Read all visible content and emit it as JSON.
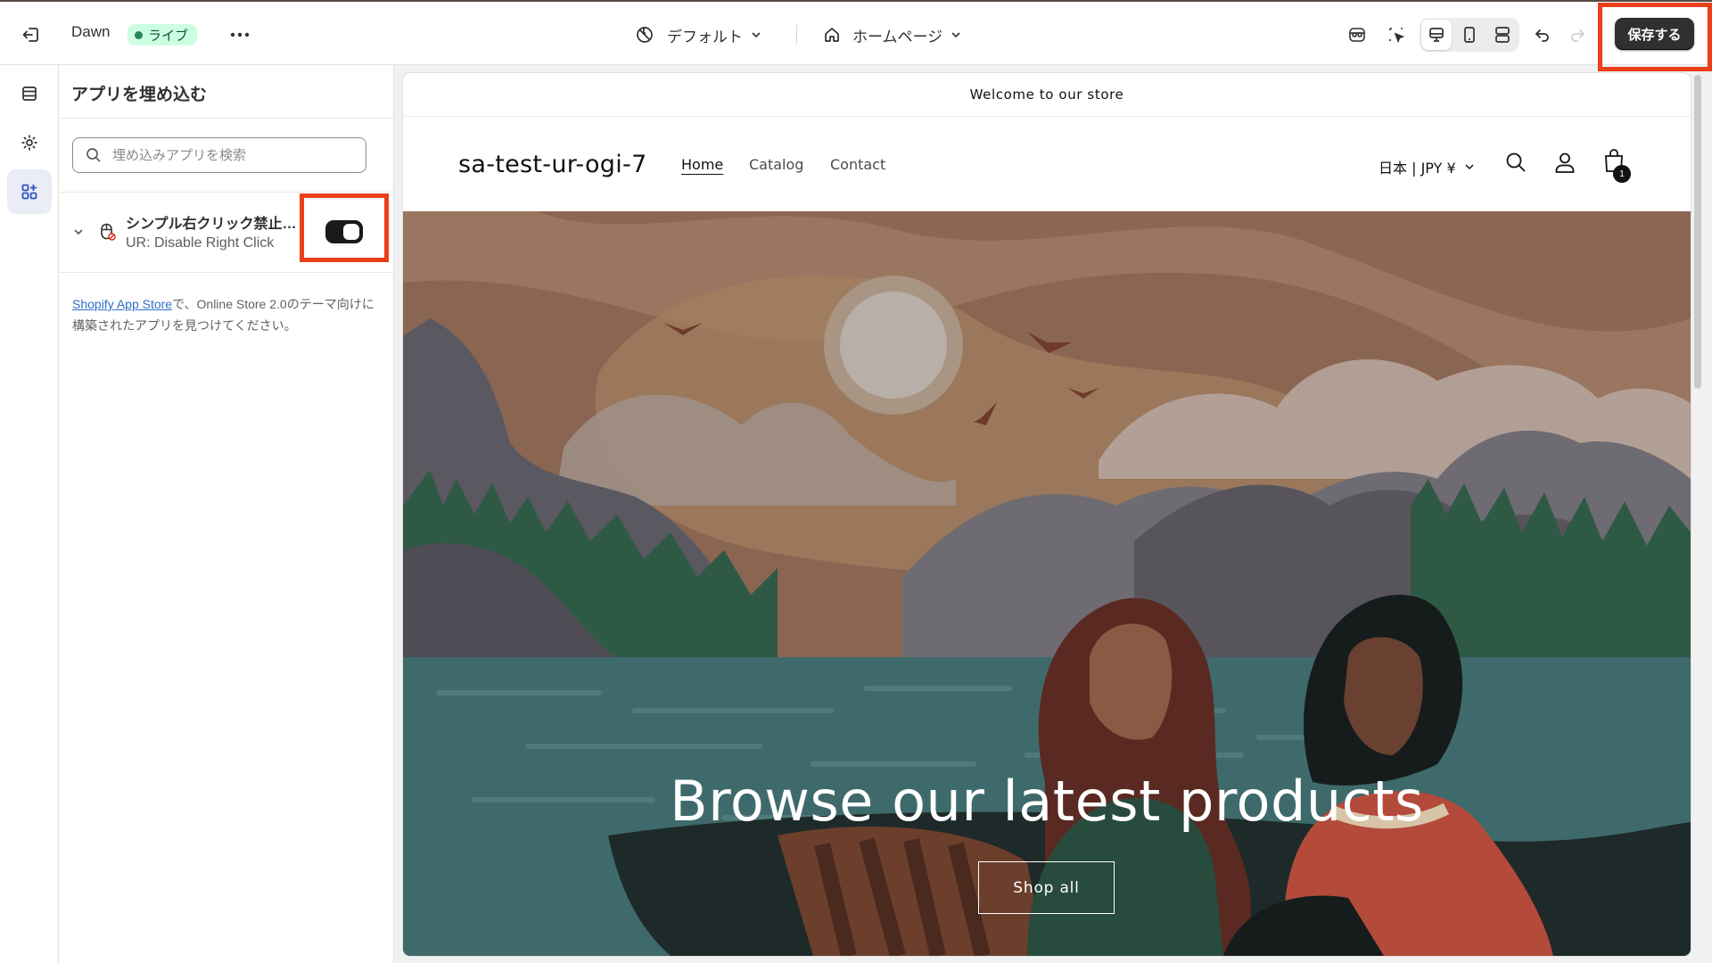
{
  "topbar": {
    "theme_name": "Dawn",
    "live_label": "ライブ",
    "template_label": "デフォルト",
    "page_label": "ホームページ",
    "save_label": "保存する"
  },
  "sidebar": {
    "title": "アプリを埋め込む",
    "search_placeholder": "埋め込みアプリを検索",
    "app": {
      "name": "シンプル右クリック禁止アプリ",
      "subtitle": "UR: Disable Right Click",
      "enabled": true
    },
    "help_link": "Shopify App Store",
    "help_text": "で、Online Store 2.0のテーマ向けに構築されたアプリを見つけてください。"
  },
  "preview": {
    "announcement": "Welcome to our store",
    "store_name": "sa-test-ur-ogi-7",
    "nav": [
      "Home",
      "Catalog",
      "Contact"
    ],
    "currency": "日本 | JPY ¥",
    "cart_count": "1",
    "hero_heading": "Browse our latest products",
    "hero_button": "Shop all"
  },
  "colors": {
    "save_button": "#303030",
    "highlight": "#ea3f1a",
    "live_badge_bg": "#cdfee1",
    "toggle_on": "#1a1a1a"
  }
}
